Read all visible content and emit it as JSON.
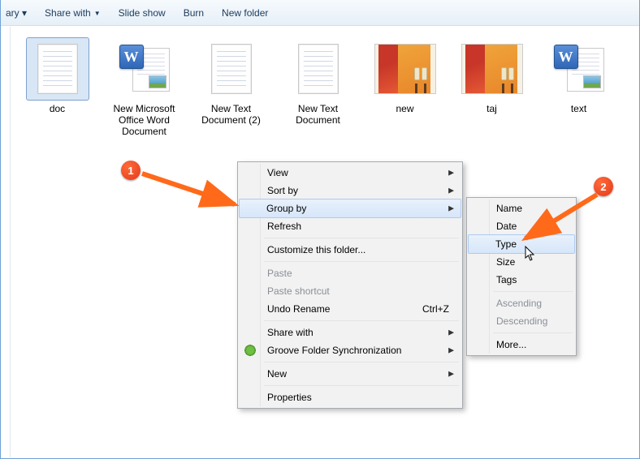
{
  "toolbar": {
    "library_trunc": "ary ▾",
    "share_with": "Share with",
    "slideshow": "Slide show",
    "burn": "Burn",
    "new_folder": "New folder"
  },
  "files": [
    {
      "name": "doc",
      "kind": "text",
      "selected": true
    },
    {
      "name": "New Microsoft Office Word Document",
      "kind": "word",
      "selected": false
    },
    {
      "name": "New Text Document (2)",
      "kind": "text",
      "selected": false
    },
    {
      "name": "New Text Document",
      "kind": "text",
      "selected": false
    },
    {
      "name": "new",
      "kind": "image",
      "selected": false
    },
    {
      "name": "taj",
      "kind": "image",
      "selected": false
    },
    {
      "name": "text",
      "kind": "word",
      "selected": false
    }
  ],
  "context_menu": {
    "view": "View",
    "sort_by": "Sort by",
    "group_by": "Group by",
    "refresh": "Refresh",
    "customize": "Customize this folder...",
    "paste": "Paste",
    "paste_shortcut": "Paste shortcut",
    "undo_rename": "Undo Rename",
    "undo_shortcut": "Ctrl+Z",
    "share_with": "Share with",
    "groove": "Groove Folder Synchronization",
    "new": "New",
    "properties": "Properties"
  },
  "submenu": {
    "name": "Name",
    "date": "Date",
    "type": "Type",
    "size": "Size",
    "tags": "Tags",
    "ascending": "Ascending",
    "descending": "Descending",
    "more": "More..."
  },
  "callouts": {
    "step1": "1",
    "step2": "2"
  }
}
